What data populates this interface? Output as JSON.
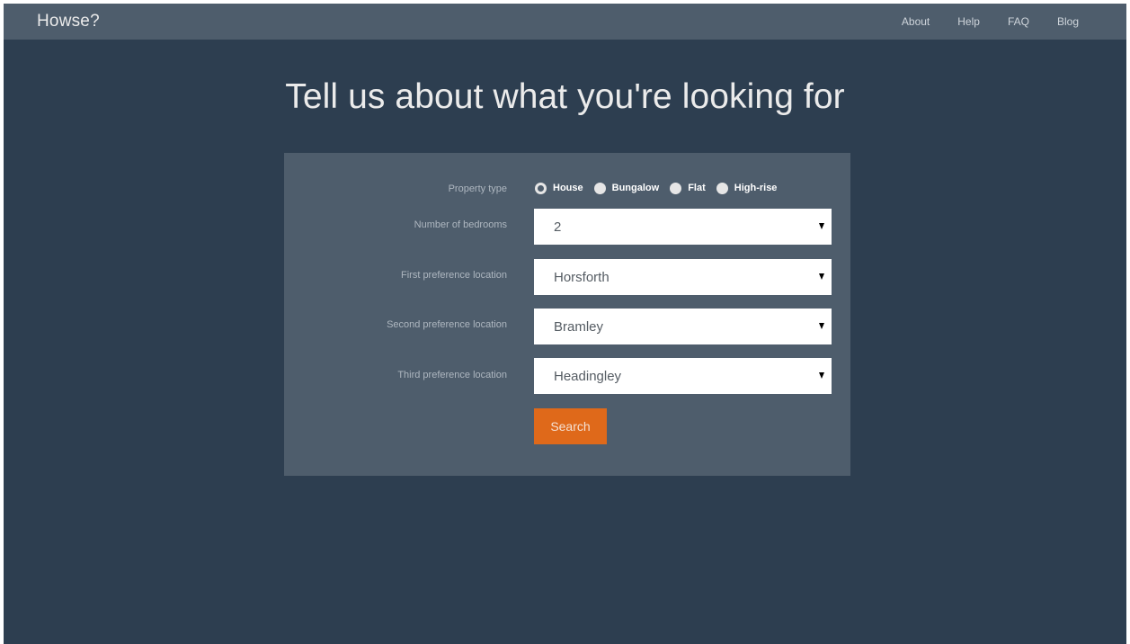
{
  "navbar": {
    "brand": "Howse?",
    "links": [
      {
        "label": "About"
      },
      {
        "label": "Help"
      },
      {
        "label": "FAQ"
      },
      {
        "label": "Blog"
      }
    ]
  },
  "page": {
    "headline": "Tell us about what you're looking for"
  },
  "form": {
    "property_type": {
      "label": "Property type",
      "options": [
        {
          "label": "House",
          "checked": true
        },
        {
          "label": "Bungalow",
          "checked": false
        },
        {
          "label": "Flat",
          "checked": false
        },
        {
          "label": "High-rise",
          "checked": false
        }
      ]
    },
    "bedrooms": {
      "label": "Number of bedrooms",
      "value": "2"
    },
    "first_location": {
      "label": "First preference location",
      "value": "Horsforth"
    },
    "second_location": {
      "label": "Second preference location",
      "value": "Bramley"
    },
    "third_location": {
      "label": "Third preference location",
      "value": "Headingley"
    },
    "search_label": "Search"
  },
  "colors": {
    "background": "#2d3e50",
    "navbar": "#4e5d6c",
    "panel": "#4e5d6c",
    "accent": "#df691a"
  },
  "icons": {
    "select_caret": "caret-down-icon"
  }
}
